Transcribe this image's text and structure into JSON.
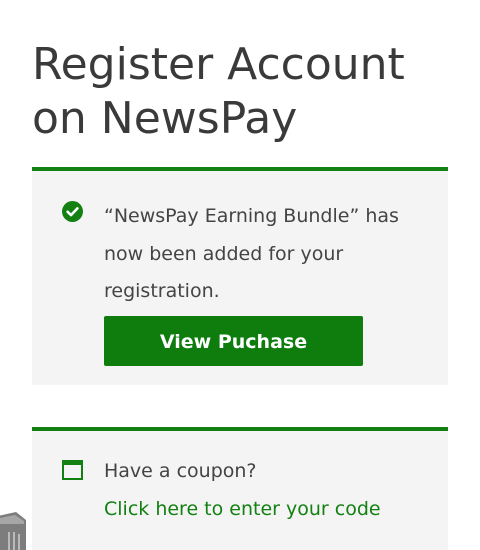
{
  "header": {
    "title": "Register Account on NewsPay"
  },
  "success_notice": {
    "message": "“NewsPay Earning Bundle” has now been added for your registration.",
    "button_label": "View Puchase",
    "icon": "check-circle-icon",
    "accent_color": "#138012"
  },
  "coupon_notice": {
    "question": "Have a coupon?",
    "link_text": "Click here to enter your code",
    "icon": "window-icon",
    "accent_color": "#138012"
  },
  "colors": {
    "accent": "#138012",
    "button_bg": "#0e7d0e",
    "panel_bg": "#f4f4f4",
    "text": "#444444"
  }
}
